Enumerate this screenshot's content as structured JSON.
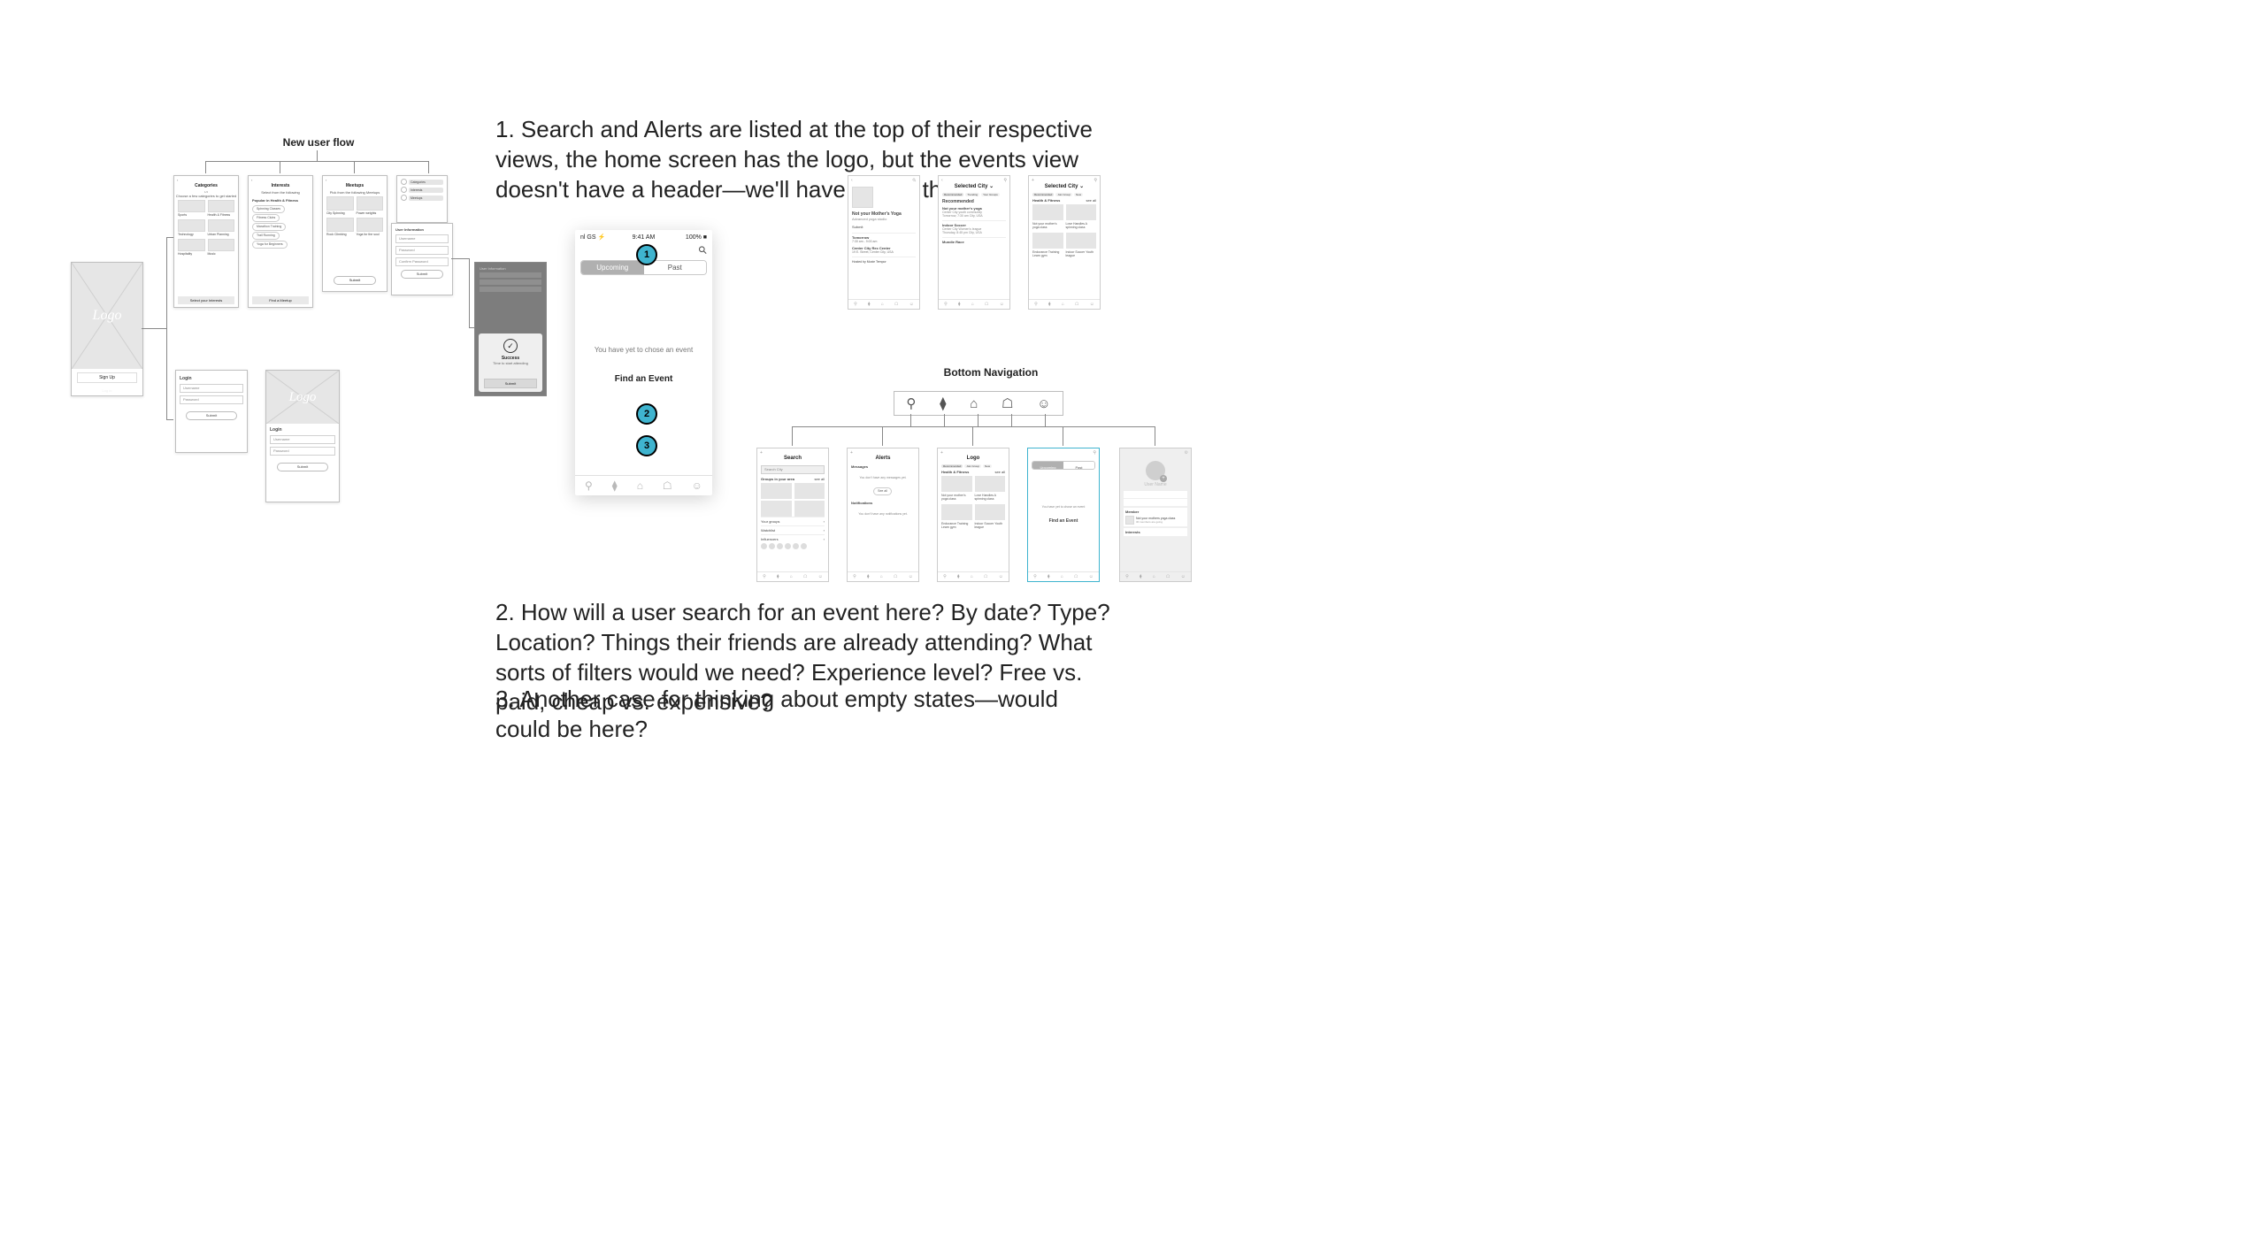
{
  "left": {
    "title": "New user flow",
    "splash": {
      "logo": "Logo",
      "signup": "Sign Up",
      "login": "Log in"
    },
    "login_panel": {
      "title": "Login",
      "username": "Username",
      "password": "Password",
      "submit": "Submit"
    },
    "login_combo": {
      "logo": "Logo",
      "title": "Login",
      "username": "Username",
      "password": "Password",
      "submit": "Submit"
    },
    "categories": {
      "title": "Categories",
      "subtitle": "Choose a few categories to get started",
      "items": [
        "Sports",
        "Health & Fitness",
        "Technology",
        "Urban Planning",
        "Hospitality",
        "Music"
      ],
      "cta": "Select your Interests"
    },
    "interests": {
      "title": "Interests",
      "subtitle": "Select from the following",
      "section": "Popular in Health & Fitness",
      "chips": [
        "Spinning Classes",
        "Fitness Clubs",
        "Marathon Training",
        "Trail Running",
        "Yoga for Beginners"
      ],
      "cta": "Find a Meetup"
    },
    "meetups": {
      "title": "Meetups",
      "subtitle": "Pick from the following Meetups",
      "items": [
        "City Spinning",
        "Power weights",
        "Rock Climbing",
        "Yoga for the soul"
      ],
      "cta": "Submit"
    },
    "sidebar_chips": [
      "Categories",
      "Interests",
      "Meetups"
    ],
    "user_info": {
      "title": "User Information",
      "fields": [
        "Username",
        "Password",
        "Confirm Password"
      ],
      "cta": "Submit"
    },
    "success": {
      "title": "Success",
      "subtitle": "Time to start attending",
      "cta": "Submit"
    }
  },
  "center": {
    "status": {
      "left": "nl GS ⚡",
      "time": "9:41 AM",
      "right": "100% ■"
    },
    "search_icon": "⚲",
    "segmented": {
      "on": "Upcoming",
      "off": "Past"
    },
    "empty": "You have yet to chose an event",
    "cta": "Find an Event",
    "badges": [
      "1",
      "2",
      "3"
    ]
  },
  "annotations": {
    "a1": "1. Search and Alerts are listed at the top of their respective views, the home screen has the logo, but the events view doesn't have a header—we'll have to add this.",
    "a2": "2. How will a user search for an event here? By date? Type? Location? Things their friends are already attending? What sorts of filters would we need? Experience level? Free vs. paid, cheap vs. expensive?",
    "a3": "3. Another case for thinking about empty states—would could be here?"
  },
  "top_right": {
    "detail": {
      "title": "Not your Mother's Yoga",
      "subtitle": "Advanced yoga studio",
      "submit": "Submit",
      "when_label": "Tomorrow",
      "when": "7:30 am - 9:00 am",
      "where_t": "Center City Rec Center",
      "where": "19 E. Street, Center City, USA",
      "host": "Hosted by Moxie Tempor"
    },
    "home": {
      "title": "Selected City ⌄",
      "chips": [
        "Recommended",
        "Trending",
        "Your Groups"
      ],
      "section": "Recommended",
      "card1_t": "Not your mother's yoga",
      "card1_s": "Center City youth community",
      "card1_w": "Tomorrow, 7:30 am City, USA",
      "card2_t": "Indoor Soccer",
      "card2_s": "Center City Women's league",
      "card2_w": "Thursday, 8:45 pm City, USA",
      "card3_t": "Mundie Race"
    },
    "browse": {
      "title": "Selected City ⌄",
      "chips": [
        "Recommended",
        "Join Group",
        "New"
      ],
      "section": "Health & Fitness",
      "see_all": "see all",
      "caps": [
        "Not your mother's yoga class",
        "Love Handles A spinning class",
        "Endurance Training Learn gym",
        "Indoor Soccer Youth league"
      ]
    }
  },
  "bottom_nav": {
    "title": "Bottom Navigation"
  },
  "bottom_phones": {
    "search": {
      "title": "Search",
      "placeholder": "Search City",
      "section": "Groups in your area",
      "see_all": "see all",
      "rows": [
        "Your groups",
        "Watchlist",
        "Influencers"
      ]
    },
    "alerts": {
      "title": "Alerts",
      "messages_h": "Messages",
      "messages_empty": "You don't have any messages yet.",
      "see_all": "See all",
      "notif_h": "Notifications",
      "notif_empty": "You don't have any notifications yet."
    },
    "home": {
      "title": "Logo",
      "chips": [
        "Recommended",
        "Join Group",
        "New"
      ],
      "section": "Health & Fitness",
      "see_all": "see all",
      "caps": [
        "Not your mother's yoga class",
        "Love Handles A spinning class",
        "Endurance Training Learn gym",
        "Indoor Soccer Youth league"
      ]
    },
    "events": {
      "seg_on": "Upcoming",
      "seg_off": "Past",
      "empty": "You have yet to chose an event",
      "cta": "Find an Event"
    },
    "profile": {
      "name": "User Name",
      "member_h": "Member",
      "member_of": "Not your mothers yoga class",
      "member_sub": "30 members are going",
      "interests_h": "Interests"
    }
  }
}
